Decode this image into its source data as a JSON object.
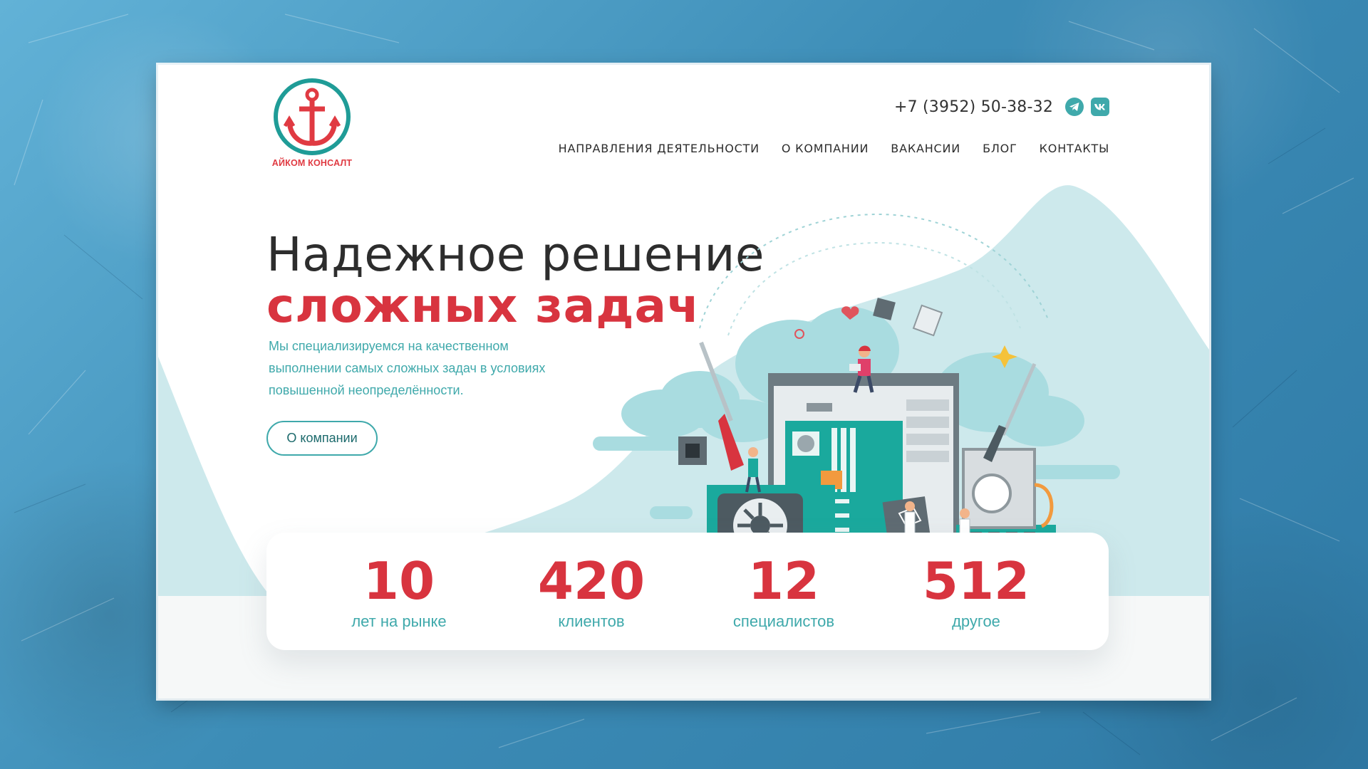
{
  "brand": {
    "name": "АЙКОМ КОНСАЛТ"
  },
  "contacts": {
    "phone": "+7 (3952) 50-38-32"
  },
  "social": [
    {
      "name": "telegram",
      "icon": "telegram-icon"
    },
    {
      "name": "vk",
      "icon": "vk-icon"
    }
  ],
  "nav": [
    "НАПРАВЛЕНИЯ ДЕЯТЕЛЬНОСТИ",
    "О КОМПАНИИ",
    "ВАКАНСИИ",
    "БЛОГ",
    "КОНТАКТЫ"
  ],
  "hero": {
    "title_line1": "Надежное решение",
    "title_line2": "сложных задач",
    "description": "Мы специализируемся на качественном выполнении самых сложных задач в условиях повышенной неопределённости.",
    "button_label": "О компании"
  },
  "stats": [
    {
      "value": "10",
      "label": "лет на рынке"
    },
    {
      "value": "420",
      "label": "клиентов"
    },
    {
      "value": "12",
      "label": "специалистов"
    },
    {
      "value": "512",
      "label": "другое"
    }
  ],
  "colors": {
    "accent_red": "#d8343f",
    "teal": "#3fa9ab",
    "light_teal": "#cde9ec",
    "background_blue": "#3f8fb7"
  }
}
